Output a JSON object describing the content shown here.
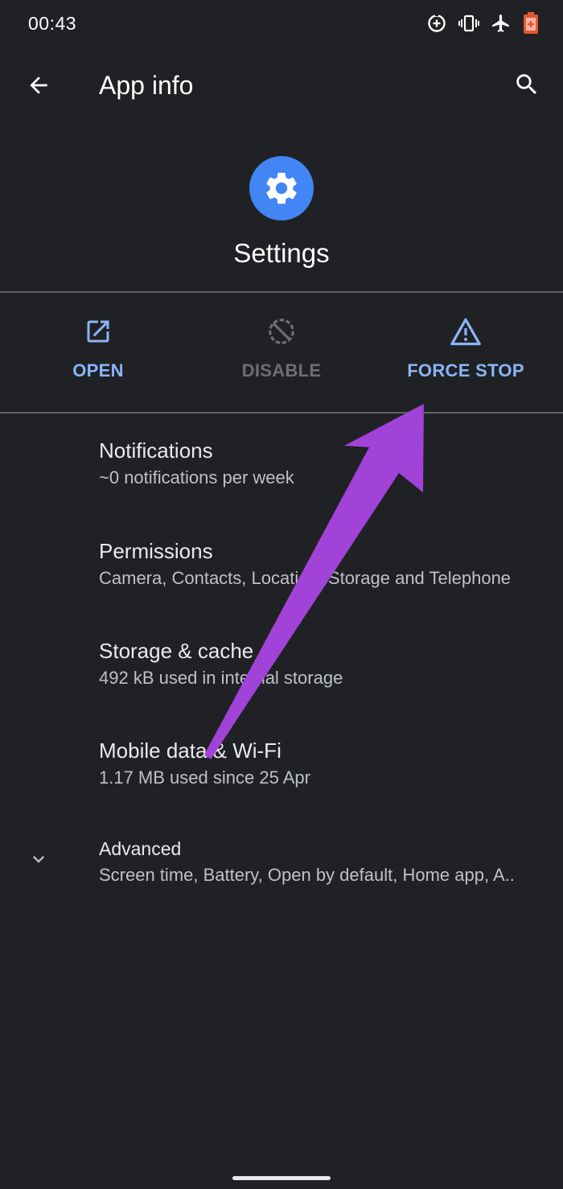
{
  "status_bar": {
    "time": "00:43",
    "icons": [
      "data-saver-icon",
      "vibrate-icon",
      "airplane-mode-icon",
      "battery-saver-icon"
    ]
  },
  "app_bar": {
    "title": "App info",
    "back_icon": "back-arrow-icon",
    "search_icon": "search-icon"
  },
  "app": {
    "name": "Settings",
    "icon": "settings-gear-icon",
    "icon_color": "#4285f4"
  },
  "actions": [
    {
      "label": "OPEN",
      "icon": "open-external-icon",
      "enabled": true
    },
    {
      "label": "DISABLE",
      "icon": "disable-icon",
      "enabled": false
    },
    {
      "label": "FORCE STOP",
      "icon": "warning-icon",
      "enabled": true
    }
  ],
  "items": [
    {
      "title": "Notifications",
      "subtitle": "~0 notifications per week"
    },
    {
      "title": "Permissions",
      "subtitle": "Camera, Contacts, Location, Storage and Telephone"
    },
    {
      "title": "Storage & cache",
      "subtitle": "492 kB used in internal storage"
    },
    {
      "title": "Mobile data & Wi-Fi",
      "subtitle": "1.17 MB used since 25 Apr"
    }
  ],
  "advanced": {
    "title": "Advanced",
    "subtitle": "Screen time, Battery, Open by default, Home app, A..",
    "icon": "chevron-down-icon"
  },
  "colors": {
    "background": "#202124",
    "accent": "#8ab4f8",
    "disabled": "#6b6f74",
    "annotation_arrow": "#a142d8",
    "battery_saver": "#e8552f"
  }
}
